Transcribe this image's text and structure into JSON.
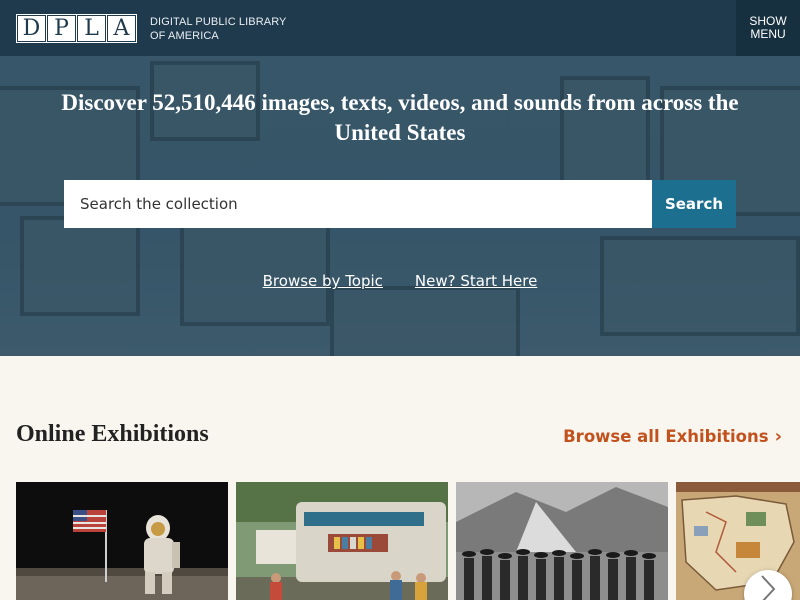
{
  "header": {
    "logo_letters": [
      "D",
      "P",
      "L",
      "A"
    ],
    "logo_line1": "Digital Public Library",
    "logo_line2": "of America",
    "menu_line1": "SHOW",
    "menu_line2": "MENU"
  },
  "hero": {
    "title": "Discover 52,510,446 images, texts, videos, and sounds from across the United States",
    "search_placeholder": "Search the collection",
    "search_button": "Search",
    "links": [
      "Browse by Topic",
      "New? Start Here"
    ]
  },
  "exhibitions": {
    "title": "Online Exhibitions",
    "browse_all": "Browse all Exhibitions",
    "cards": [
      {
        "icon": "moon-landing-image"
      },
      {
        "icon": "bookmobile-image"
      },
      {
        "icon": "workers-group-image"
      },
      {
        "icon": "map-image"
      }
    ]
  },
  "colors": {
    "header": "#1f3a4d",
    "search_button": "#1d6f8f",
    "accent_link": "#c2521d",
    "page_bg": "#f9f5ef"
  }
}
